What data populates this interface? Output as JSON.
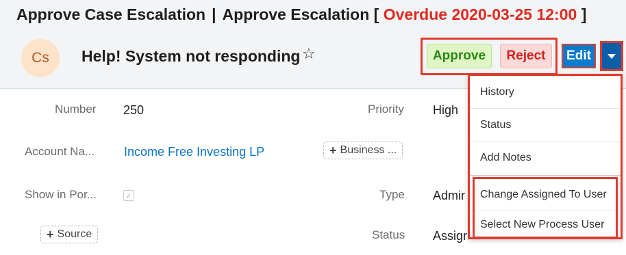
{
  "header": {
    "module": "Approve Case Escalation",
    "separator": "|",
    "activity": "Approve Escalation",
    "bracket_open": "[",
    "overdue": "Overdue 2020-03-25 12:00",
    "bracket_close": "]"
  },
  "record": {
    "avatar_initials": "Cs",
    "name": "Help! System not responding",
    "star_icon": "☆"
  },
  "actions": {
    "approve": "Approve",
    "reject": "Reject",
    "edit": "Edit"
  },
  "fields": {
    "number_label": "Number",
    "number_value": "250",
    "priority_label": "Priority",
    "priority_value": "High",
    "account_label": "Account Na...",
    "account_value": "Income Free Investing LP",
    "business_pill": "Business ...",
    "show_portal_label": "Show in Por...",
    "show_portal_check": "✓",
    "type_label": "Type",
    "type_value": "Admir",
    "source_pill": "Source",
    "status_label": "Status",
    "status_value": "Assigr",
    "plus": "+"
  },
  "menu": {
    "items": [
      "History",
      "Status",
      "Add Notes",
      "Change Assigned To User",
      "Select New Process User"
    ]
  },
  "colors": {
    "overdue": "#e02a1f",
    "approve_bg": "#dff5c4",
    "reject_bg": "#fbd9d9",
    "edit_bg": "#0b7bcc",
    "highlight_border": "#e03b2f",
    "link": "#0b73c9"
  }
}
